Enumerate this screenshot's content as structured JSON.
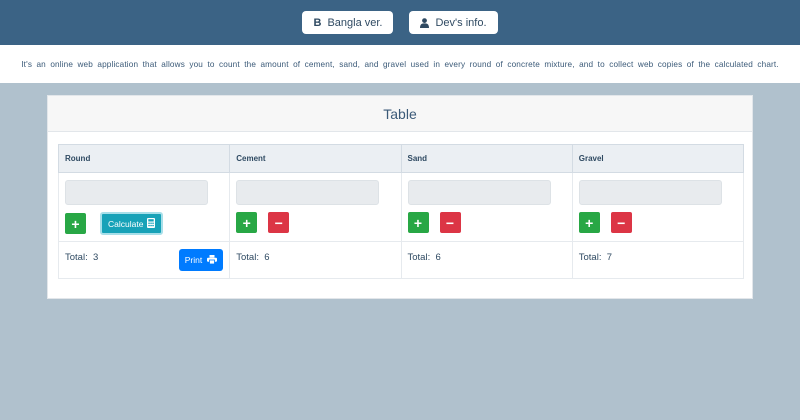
{
  "header": {
    "bangla_icon": "B",
    "bangla_label": "Bangla ver.",
    "dev_label": "Dev's info."
  },
  "intro": "It's an online web application that allows you to count the amount of cement, sand, and gravel used in every round of concrete mixture, and to collect web copies of the calculated chart.",
  "card": {
    "title": "Table"
  },
  "table": {
    "columns": [
      "Round",
      "Cement",
      "Sand",
      "Gravel"
    ],
    "calculate_label": "Calculate",
    "print_label": "Print",
    "totals": [
      {
        "label": "Total:",
        "value": "3"
      },
      {
        "label": "Total:",
        "value": "6"
      },
      {
        "label": "Total:",
        "value": "6"
      },
      {
        "label": "Total:",
        "value": "7"
      }
    ],
    "buttons": {
      "plus": "+",
      "minus": "−"
    }
  },
  "colors": {
    "header_bg": "#3b6385",
    "page_bg": "#b0c1cd",
    "plus": "#28a745",
    "minus": "#dc3545",
    "calculate": "#17a2b8",
    "print": "#007bff"
  },
  "icons": {
    "bangla": "bangla-b-icon",
    "dev": "user-icon",
    "calculate": "calculator-icon",
    "print": "printer-icon"
  }
}
